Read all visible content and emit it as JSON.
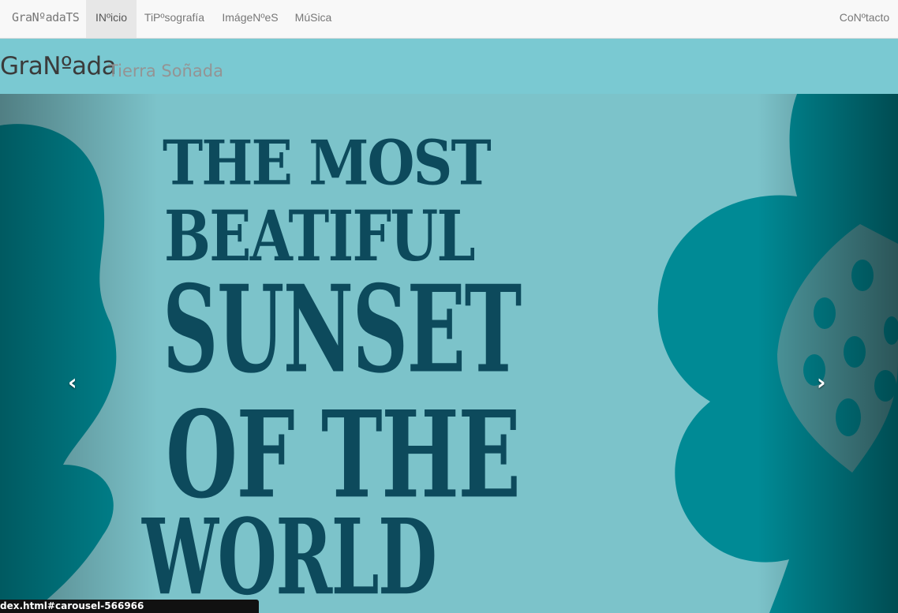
{
  "navbar": {
    "brand": "GraNºadaTS",
    "items": [
      {
        "label": "INºicio",
        "active": true
      },
      {
        "label": "TiPºsografía",
        "active": false
      },
      {
        "label": "ImágeNºeS",
        "active": false
      },
      {
        "label": "MúSica",
        "active": false
      }
    ],
    "contact": "CoNºtacto"
  },
  "header": {
    "title": "GraNºada",
    "subtitle": "Tierra Soñada"
  },
  "carousel": {
    "slide_text": [
      "THE MOST",
      "BEATIFUL",
      "SUNSET",
      "OF THE",
      "WORLD"
    ],
    "prev_icon": "chevron-left-icon",
    "next_icon": "chevron-right-icon"
  },
  "statusbar": {
    "url": "dex.html#carousel-566966"
  },
  "colors": {
    "background": "#7ac9d2",
    "poster_text": "#0d4a5c",
    "flower": "#00808a"
  }
}
